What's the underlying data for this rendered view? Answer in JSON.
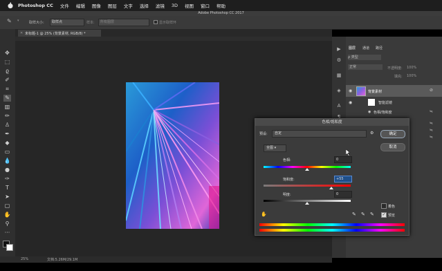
{
  "menubar": {
    "app": "Photoshop CC",
    "items": [
      "文件",
      "编辑",
      "图像",
      "图层",
      "文字",
      "选择",
      "滤镜",
      "3D",
      "视图",
      "窗口",
      "帮助"
    ]
  },
  "window": {
    "title": "Adobe Photoshop CC 2017"
  },
  "options": {
    "sample_size_label": "取样大小:",
    "sample_size_value": "取样点",
    "sample_label": "样本:",
    "sample_value": "所有图层",
    "show_ring": "显示取样环"
  },
  "document": {
    "tab": "未标题-1 @ 25% (背景素材, RGB/8) *"
  },
  "status": {
    "zoom": "25%",
    "doc": "文档:5.26M/29.1M"
  },
  "layers_panel": {
    "tabs": [
      "图层",
      "通道",
      "路径"
    ],
    "kind": "类型",
    "blend": "正常",
    "opacity_label": "不透明度:",
    "opacity": "100%",
    "fill_label": "填充:",
    "fill": "100%",
    "layers": [
      {
        "name": "背景素材"
      },
      {
        "name": "智能滤镜"
      },
      {
        "name": "色相/饱和度"
      }
    ]
  },
  "dialog": {
    "title": "色相/饱和度",
    "preset_label": "预设:",
    "preset_value": "自定",
    "channel": "全图",
    "hue_label": "色相:",
    "hue_value": "0",
    "saturation_label": "饱和度:",
    "saturation_value": "+55",
    "lightness_label": "明度:",
    "lightness_value": "0",
    "ok": "确定",
    "cancel": "取消",
    "colorize": "着色",
    "preview": "预览",
    "preview_checked": true,
    "hue_level": 0.5,
    "saturation_level": 0.78,
    "lightness_level": 0.5
  }
}
